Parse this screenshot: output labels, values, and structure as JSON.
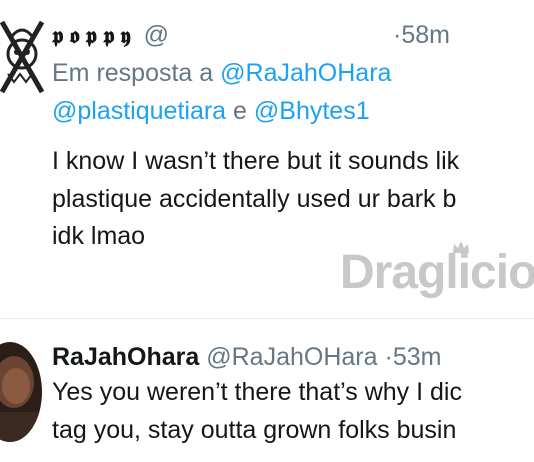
{
  "tweet1": {
    "display_name": "𝖕𝖔𝖕𝖕𝖞",
    "handle": "@",
    "separator": "·",
    "time": "58m",
    "reply_prefix": "Em resposta a",
    "reply_mention1": "@RaJahOHara",
    "reply_mention2": "@plastiquetiara",
    "reply_joiner": "e",
    "reply_mention3": "@Bhytes1",
    "text_line1": "I know I wasn’t there but it sounds lik",
    "text_line2": "plastique accidentally used ur bark b",
    "text_line3": "idk lmao"
  },
  "watermark": {
    "text": "Draglicio"
  },
  "tweet2": {
    "display_name": "RaJahOhara",
    "handle": "@RaJahOHara",
    "separator": "·",
    "time": "53m",
    "text_line1": "Yes you weren’t there that’s why I dic",
    "text_line2": "tag you, stay outta grown folks busin"
  },
  "colors": {
    "link": "#1da1f2",
    "muted": "#657786",
    "text": "#14171a"
  }
}
